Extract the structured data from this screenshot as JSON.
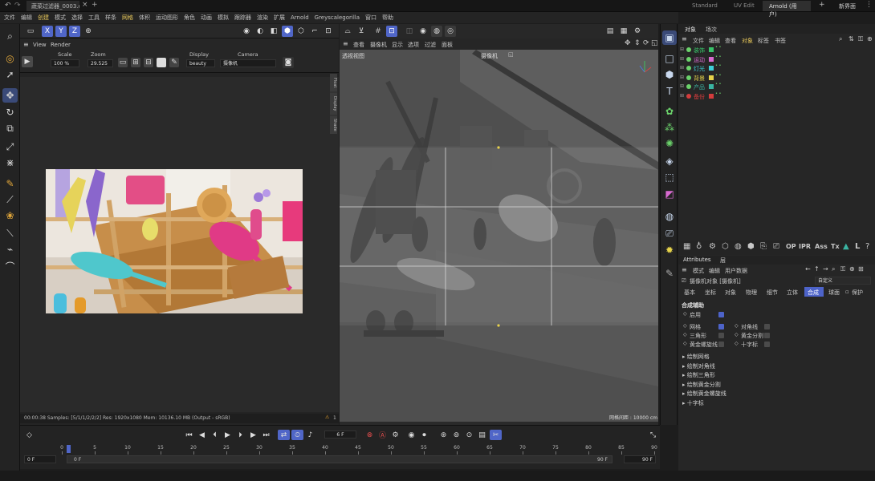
{
  "titlebar": {
    "tab": "蔬菜过滤器_0003.c...",
    "add": "+",
    "layouts": [
      "Standard",
      "UV Edit",
      "Arnold (用户)"
    ],
    "layout_add": "+",
    "new_ui": "新界面"
  },
  "menus": [
    "文件",
    "编辑",
    "创建",
    "模式",
    "选择",
    "工具",
    "样条",
    "网格",
    "体积",
    "运动图形",
    "角色",
    "动画",
    "模拟",
    "跟踪器",
    "渲染",
    "扩展",
    "Arnold",
    "Greyscalegorilla",
    "窗口",
    "帮助"
  ],
  "ir": {
    "menus": [
      "View",
      "Render"
    ],
    "scale_label": "Scale",
    "scale": "100 %",
    "zoom_label": "Zoom",
    "zoom": "29.525",
    "display_label": "Display",
    "display": "beauty",
    "camera_label": "Camera",
    "camera": "摄像机",
    "side_tabs": [
      "Float",
      "Display",
      "Shade"
    ],
    "status": "00:00:38  Samples: [5/1/1/2/2/2]  Res: 1920x1080  Mem: 10136.10 MB  (Output - sRGB)",
    "status_icon": "⚠",
    "status_num": "1"
  },
  "viewport": {
    "menus": [
      "查看",
      "摄像机",
      "显示",
      "选项",
      "过滤",
      "面板"
    ],
    "title": "透视视图",
    "camera": "摄像机",
    "grid": "网格间距 : 10000 cm"
  },
  "objects": {
    "tabs": [
      "对象",
      "场次"
    ],
    "menus": [
      "文件",
      "编辑",
      "查看",
      "对象",
      "标签",
      "书签"
    ],
    "items": [
      {
        "name": "装饰",
        "color": "#39c46a"
      },
      {
        "name": "运动",
        "color": "#d96ad0"
      },
      {
        "name": "灯光",
        "color": "#3fd0d8"
      },
      {
        "name": "背景",
        "color": "#e6d34a"
      },
      {
        "name": "产品",
        "color": "#3ab4a2"
      },
      {
        "name": "备份",
        "color": "#d33c3c"
      }
    ]
  },
  "attributes": {
    "tab": "Attributes",
    "tab2": "层",
    "menus": [
      "模式",
      "编辑",
      "用户数据"
    ],
    "object": "摄像机对象 [摄像机]",
    "preset": "自定义",
    "tabs": [
      "基本",
      "坐标",
      "对象",
      "物理",
      "细节",
      "立体",
      "合成",
      "球面"
    ],
    "active_tab": "合成",
    "section": "合成辅助",
    "enable": "启用",
    "grid_labels": [
      "网格",
      "三角形",
      "黄金螺旋线"
    ],
    "grid_labels_r": [
      "对角线",
      "黄金分割",
      "十字标"
    ],
    "groups": [
      "绘制网格",
      "绘制对角线",
      "绘制三角形",
      "绘制黄金分割",
      "绘制黄金螺旋线",
      "十字标"
    ],
    "tool_labels": [
      "OP",
      "IPR",
      "Ass",
      "Tx"
    ]
  },
  "timeline": {
    "frame": "6 F",
    "start": "0 F",
    "start2": "0 F",
    "end": "90 F",
    "end2": "90 F",
    "ticks": [
      "0",
      "5",
      "10",
      "15",
      "20",
      "25",
      "30",
      "35",
      "40",
      "45",
      "50",
      "55",
      "60",
      "65",
      "70",
      "75",
      "80",
      "85",
      "90"
    ]
  },
  "colors": {
    "accent": "#5066c8",
    "highlight": "#e8c85a"
  }
}
